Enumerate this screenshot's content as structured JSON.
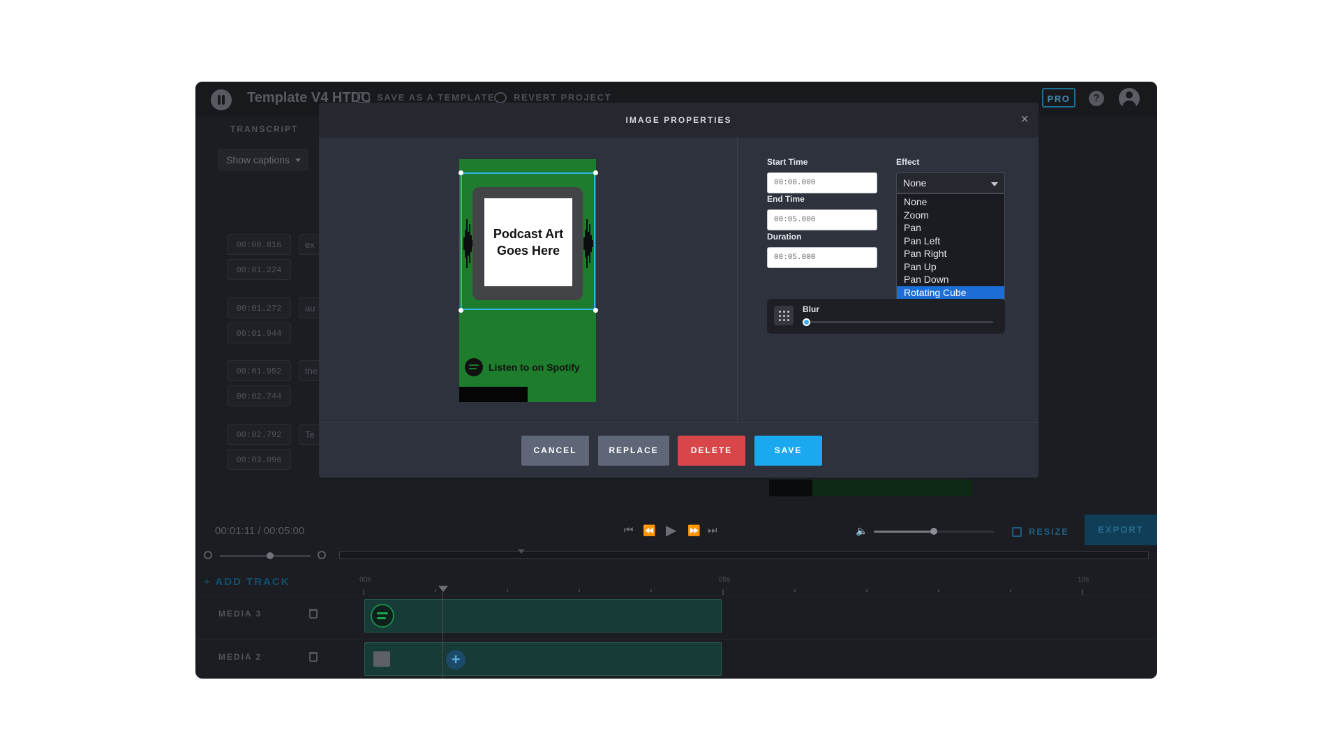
{
  "header": {
    "project_title": "Template V4 HTDC",
    "save_template": "SAVE AS A TEMPLATE",
    "revert_project": "REVERT PROJECT",
    "pro_badge": "PRO"
  },
  "transcript": {
    "label": "TRANSCRIPT",
    "show_captions": "Show captions",
    "rows": [
      {
        "start": "00:00.816",
        "end": "00:01.224",
        "text": "ex"
      },
      {
        "start": "00:01.272",
        "end": "00:01.944",
        "text": "au"
      },
      {
        "start": "00:01.952",
        "end": "00:02.744",
        "text": "the"
      },
      {
        "start": "00:02.792",
        "end": "00:03.096",
        "text": "Te"
      }
    ]
  },
  "playback": {
    "current_time": "00:01:11 / 00:05:00",
    "volume_level": 0.5,
    "resize_label": "RESIZE",
    "export_label": "EXPORT"
  },
  "timeline": {
    "add_track": "+ ADD TRACK",
    "ruler": [
      "00s",
      "05s",
      "10s"
    ],
    "tracks": [
      {
        "name": "MEDIA 3"
      },
      {
        "name": "MEDIA 2"
      }
    ]
  },
  "modal": {
    "title": "IMAGE PROPERTIES",
    "close": "×",
    "preview": {
      "card_text": "Podcast Art Goes Here",
      "listen_text": "Listen to on Spotify"
    },
    "start_time": {
      "label": "Start Time",
      "value": "00:00.000"
    },
    "end_time": {
      "label": "End Time",
      "value": "00:05.000"
    },
    "duration": {
      "label": "Duration",
      "value": "00:05.000"
    },
    "effect": {
      "label": "Effect",
      "selected": "None",
      "options": [
        "None",
        "Zoom",
        "Pan",
        "Pan Left",
        "Pan Right",
        "Pan Up",
        "Pan Down",
        "Rotating Cube"
      ],
      "highlighted": "Rotating Cube"
    },
    "blur": {
      "label": "Blur",
      "value": 0
    },
    "buttons": {
      "cancel": "CANCEL",
      "replace": "REPLACE",
      "delete": "DELETE",
      "save": "SAVE"
    }
  },
  "colors": {
    "accent": "#1aa9ef",
    "delete": "#d9464a",
    "selection": "#1b6ed6",
    "spotify_green": "#1d7d2c"
  }
}
